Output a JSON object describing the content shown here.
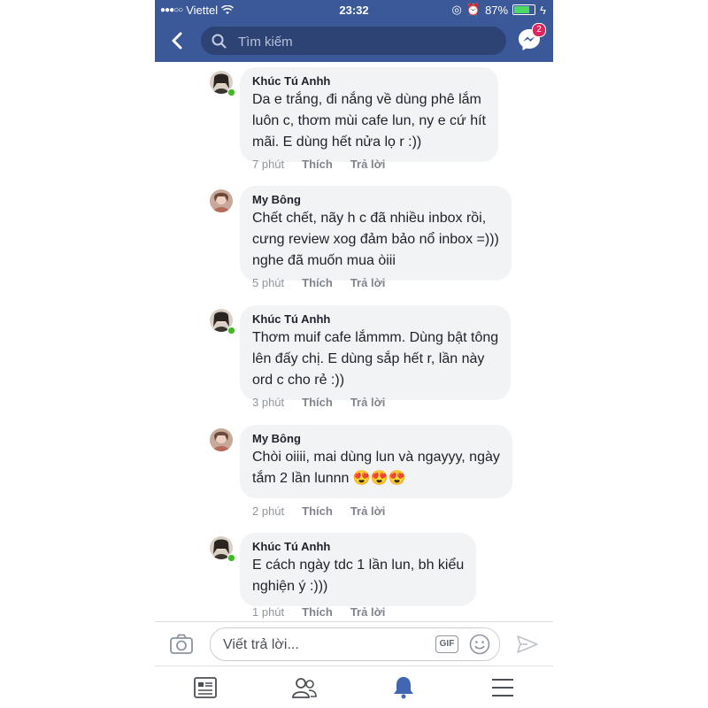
{
  "status_bar": {
    "carrier": "Viettel",
    "time": "23:32",
    "battery": "87%",
    "battery_level": 0.87
  },
  "header": {
    "search_placeholder": "Tìm kiếm",
    "messenger_badge": "2"
  },
  "comments": [
    {
      "author": "Khúc Tú Anhh",
      "lines": [
        "Da e trắng, đi nắng về dùng phê lắm",
        "luôn c, thơm mùi cafe lun, ny e cứ hít",
        "mãi. E dùng hết nửa lọ r :))"
      ],
      "time": "7 phút",
      "like": "Thích",
      "reply": "Trả lời",
      "online": true
    },
    {
      "author": "My Bông",
      "lines": [
        "Chết chết, nãy h c đã nhiều inbox rồi,",
        "cưng review xog đảm bảo nổ inbox =)))",
        "nghe đã muốn mua òiii"
      ],
      "time": "5 phút",
      "like": "Thích",
      "reply": "Trả lời",
      "online": false
    },
    {
      "author": "Khúc Tú Anhh",
      "lines": [
        "Thơm muif cafe lắmmm. Dùng bật tông",
        "lên đấy chị. E dùng sắp hết r, lần này",
        "ord c cho rẻ :))"
      ],
      "time": "3 phút",
      "like": "Thích",
      "reply": "Trả lời",
      "online": true
    },
    {
      "author": "My Bông",
      "lines": [
        "Chòi oiiii, mai dùng lun và ngayyy, ngày",
        "tắm 2 lần lunnn 😍😍😍"
      ],
      "time": "2 phút",
      "like": "Thích",
      "reply": "Trả lời",
      "online": false
    },
    {
      "author": "Khúc Tú Anhh",
      "lines": [
        "E cách ngày tdc 1 lần lun, bh kiểu",
        "nghiện ý :)))"
      ],
      "time": "1 phút",
      "like": "Thích",
      "reply": "Trả lời",
      "online": true
    }
  ],
  "reply_bar": {
    "placeholder": "Viết trả lời...",
    "gif_label": "GIF"
  },
  "tab_bar": {
    "tabs": [
      "news-feed-icon",
      "friends-icon",
      "notifications-icon",
      "menu-icon"
    ]
  },
  "colors": {
    "brand": "#3b5998",
    "bubble": "#f2f3f5",
    "active_tab": "#4267b2"
  }
}
